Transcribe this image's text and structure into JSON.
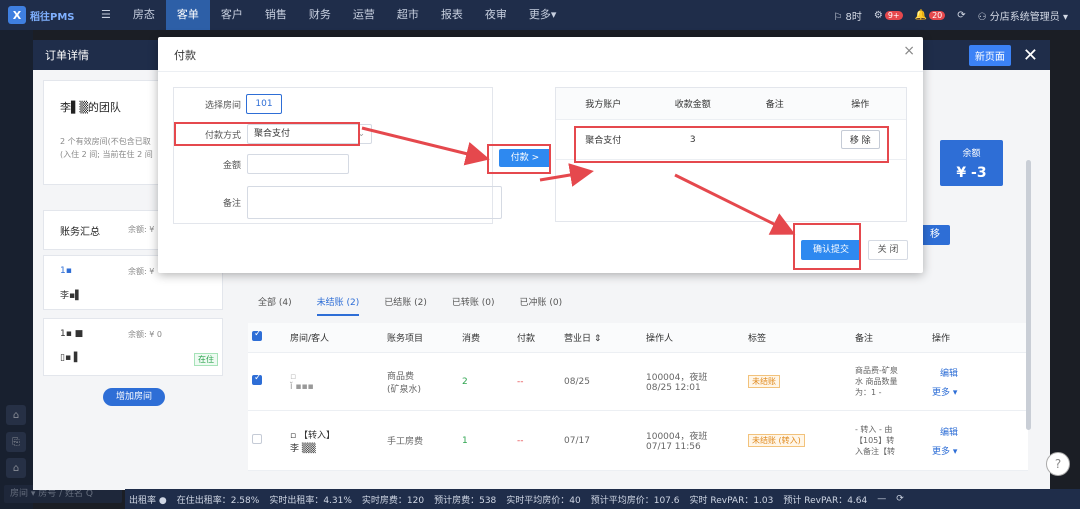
{
  "app": {
    "logo_text": "稻往PMS",
    "logo_mark": "X"
  },
  "nav": {
    "items": [
      "房态",
      "客单",
      "客户",
      "销售",
      "财务",
      "运营",
      "超市",
      "报表",
      "夜审",
      "更多▾"
    ],
    "active_index": 1
  },
  "topright": {
    "flag_label": "⚐ 8时",
    "badge1": "9+",
    "badge2": "20",
    "user": "⚇ 分店系统管理员 ▾"
  },
  "drawer": {
    "title": "订单详情",
    "new_page": "新页面",
    "close": "✕"
  },
  "group": {
    "name": "李▌▒的团队",
    "desc": "2 个有效房间(不包含已取",
    "desc2": "(入住 2 间; 当前在住 2 间"
  },
  "summary": {
    "title": "账务汇总",
    "balance": "余额: ¥",
    "room1": "1▪",
    "room1_balance": "余额: ¥",
    "guest1": "李▪▌",
    "room2": "1▪ ■",
    "room2_balance": "余额: ¥ 0",
    "guest2": "▯▪ ▌",
    "status": "在住",
    "add_room": "增加房间"
  },
  "balance_box": {
    "label": "余额",
    "value": "¥ -3"
  },
  "transfer": "移",
  "tabs": [
    {
      "label": "全部 (4)",
      "active": false
    },
    {
      "label": "未结账 (2)",
      "active": true
    },
    {
      "label": "已结账 (2)",
      "active": false
    },
    {
      "label": "已转账 (0)",
      "active": false
    },
    {
      "label": "已冲账 (0)",
      "active": false
    }
  ],
  "table": {
    "headers": [
      "",
      "房间/客人",
      "账务项目",
      "消费",
      "付款",
      "营业日 ⇕",
      "操作人",
      "标签",
      "备注",
      "操作"
    ],
    "rows": [
      {
        "checked": true,
        "room": "▫",
        "guest": "ǐ ▪▪▪",
        "item": "商品费\n(矿泉水)",
        "consume": "2",
        "pay": "--",
        "date": "08/25",
        "operator": "100004，夜班\n08/25 12:01",
        "tag": "未结账",
        "note": "商品费-矿泉\n水 商品数量\n为：1 -",
        "edit": "编辑",
        "more": "更多 ▾"
      },
      {
        "checked": false,
        "room": "▫ 【转入】",
        "guest": "李 ▒▒",
        "item": "手工房费",
        "consume": "1",
        "pay": "--",
        "date": "07/17",
        "operator": "100004，夜班\n07/17 11:56",
        "tag": "未结账 (转入)",
        "note": "- 转入 - 由\n【105】转\n入备注【转",
        "edit": "编辑",
        "more": "更多 ▾"
      }
    ]
  },
  "statusbar": {
    "items": [
      "出租率 ●",
      "在住出租率：2.58%",
      "实时出租率：4.31%",
      "实时房费：120",
      "预计房费：538",
      "实时平均房价：40",
      "预计平均房价：107.6",
      "实时 RevPAR：1.03",
      "预计 RevPAR：4.64",
      "—",
      "⟳"
    ]
  },
  "search": {
    "placeholder": "房间 ▾ 房号 / 姓名 Q"
  },
  "help": "?",
  "modal": {
    "title": "付款",
    "close": "×",
    "room_label": "选择房间",
    "room_value": "101",
    "method_label": "付款方式",
    "method_value": "聚合支付",
    "amount_label": "金额",
    "amount_value": "",
    "note_label": "备注",
    "note_value": "",
    "pay_button": "付款 >",
    "accounts": {
      "headers": [
        "我方账户",
        "收款金额",
        "备注",
        "操作"
      ],
      "rows": [
        {
          "account": "聚合支付",
          "amount": "3",
          "note": "",
          "action": "移 除"
        }
      ]
    },
    "submit": "确认提交",
    "cancel": "关 闭"
  },
  "colors": {
    "accent": "#2e89f0",
    "highlight": "#e5484d",
    "nav_bg": "#1f2d4a"
  }
}
